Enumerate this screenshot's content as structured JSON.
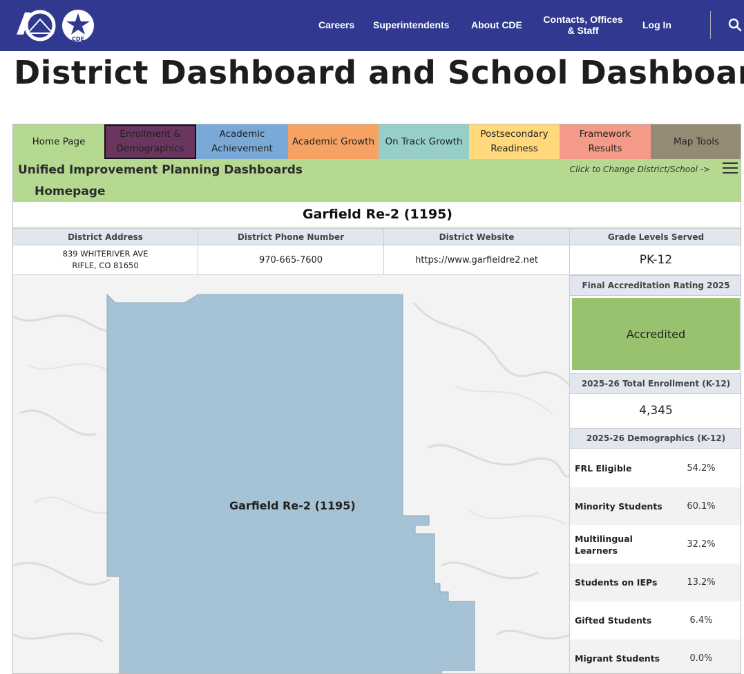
{
  "header": {
    "nav": [
      "Careers",
      "Superintendents",
      "About CDE",
      "Contacts, Offices & Staff",
      "Log In"
    ],
    "logo_text": "CDE"
  },
  "page_title": "District Dashboard and School Dashboard",
  "tabs": [
    {
      "label": "Home Page",
      "color": "#b5d991"
    },
    {
      "label": "Enrollment & Demographics",
      "color": "#6a3660"
    },
    {
      "label": "Academic Achievement",
      "color": "#7aa9d8"
    },
    {
      "label": "Academic Growth",
      "color": "#f5a263"
    },
    {
      "label": "On Track Growth",
      "color": "#97cfc8"
    },
    {
      "label": "Postsecondary Readiness",
      "color": "#ffd97c"
    },
    {
      "label": "Framework Results",
      "color": "#f49a88"
    },
    {
      "label": "Map Tools",
      "color": "#958a73"
    }
  ],
  "dashboard": {
    "title": "Unified Improvement Planning Dashboards",
    "subtitle": "Homepage",
    "change_link": "Click to Change District/School ->",
    "district_name": "Garfield Re-2 (1195)"
  },
  "info": {
    "address_head": "District Address",
    "address_line1": "839 WHITERIVER AVE",
    "address_line2": "RIFLE, CO 81650",
    "phone_head": "District Phone Number",
    "phone": "970-665-7600",
    "website_head": "District Website",
    "website": "https://www.garfieldre2.net",
    "grades_head": "Grade Levels Served",
    "grades": "PK-12"
  },
  "map": {
    "label": "Garfield Re-2 (1195)",
    "fill_color": "#a6c3d6"
  },
  "sidebar": {
    "accreditation_head": "Final Accreditation Rating 2025",
    "accreditation_value": "Accredited",
    "enrollment_head": "2025-26 Total Enrollment (K-12)",
    "enrollment_value": "4,345",
    "demographics_head": "2025-26 Demographics (K-12)",
    "demographics": [
      {
        "label": "FRL Eligible",
        "value": "54.2%"
      },
      {
        "label": "Minority Students",
        "value": "60.1%"
      },
      {
        "label": "Multilingual Learners",
        "value": "32.2%"
      },
      {
        "label": "Students on IEPs",
        "value": "13.2%"
      },
      {
        "label": "Gifted Students",
        "value": "6.4%"
      },
      {
        "label": "Migrant Students",
        "value": "0.0%"
      }
    ]
  }
}
